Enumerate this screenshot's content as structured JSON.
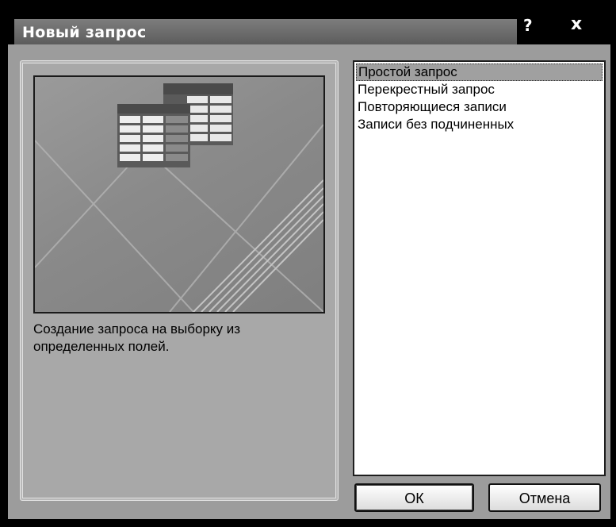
{
  "window": {
    "title": "Новый запрос",
    "help_label": "?",
    "close_label": "x"
  },
  "preview": {
    "description": "Создание запроса на выборку из определенных полей."
  },
  "query_types": [
    {
      "label": "Простой запрос",
      "selected": true
    },
    {
      "label": "Перекрестный запрос",
      "selected": false
    },
    {
      "label": "Повторяющиеся записи",
      "selected": false
    },
    {
      "label": "Записи без подчиненных",
      "selected": false
    }
  ],
  "buttons": {
    "ok_label": "ОК",
    "cancel_label": "Отмена"
  },
  "colors": {
    "title_bar": "#6b6b6b",
    "client_bg": "#9c9c9c",
    "selection": "#a0a0a0"
  }
}
